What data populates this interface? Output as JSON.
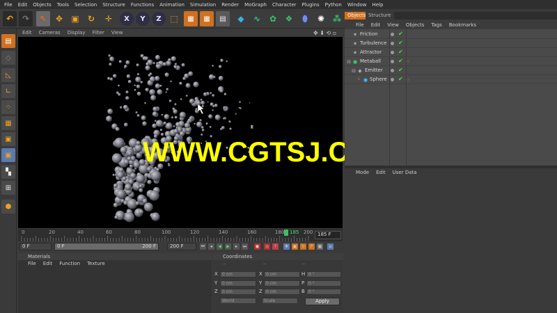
{
  "menubar": [
    "File",
    "Edit",
    "Objects",
    "Tools",
    "Selection",
    "Structure",
    "Functions",
    "Animation",
    "Simulation",
    "Render",
    "MoGraph",
    "Character",
    "Plugins",
    "Python",
    "Window",
    "Help"
  ],
  "toolbar": {
    "axis_x": "X",
    "axis_y": "Y",
    "axis_z": "Z"
  },
  "viewport": {
    "menu": [
      "Edit",
      "Cameras",
      "Display",
      "Filter",
      "View"
    ],
    "nav_icons": "✥ ⬇ ⟲ ▫"
  },
  "watermark": "WWW.CGTSJ.COM",
  "timeline": {
    "ticks": [
      "0",
      "20",
      "40",
      "60",
      "80",
      "100",
      "120",
      "140",
      "160",
      "180",
      "185",
      "200"
    ],
    "current_frame": "185 F"
  },
  "transport": {
    "start": "0 F",
    "range_start": "0 F",
    "range_end": "200 F",
    "end": "200 F"
  },
  "materials": {
    "title": "Materials",
    "menu": [
      "File",
      "Edit",
      "Function",
      "Texture"
    ]
  },
  "coordinates": {
    "title": "Coordinates",
    "headers": [
      "--",
      "--",
      "--"
    ],
    "rows": [
      {
        "axis": "X",
        "pos": "0 cm",
        "axis2": "X",
        "size": "0 cm",
        "axis3": "H",
        "rot": "0 °"
      },
      {
        "axis": "Y",
        "pos": "0 cm",
        "axis2": "Y",
        "size": "0 cm",
        "axis3": "P",
        "rot": "0 °"
      },
      {
        "axis": "Z",
        "pos": "0 cm",
        "axis2": "Z",
        "size": "0 cm",
        "axis3": "B",
        "rot": "0 °"
      }
    ],
    "mode_select": "World",
    "scale_select": "Scale",
    "apply_label": "Apply"
  },
  "objects_panel": {
    "tabs": [
      "Objects",
      "Structure"
    ],
    "menu": [
      "File",
      "Edit",
      "View",
      "Objects",
      "Tags",
      "Bookmarks"
    ],
    "items": [
      {
        "name": "Friction",
        "icon": "✶"
      },
      {
        "name": "Turbulence",
        "icon": "✶"
      },
      {
        "name": "Attractor",
        "icon": "✶"
      },
      {
        "name": "Metaball",
        "icon": "●"
      },
      {
        "name": "Emitter",
        "icon": "◈"
      },
      {
        "name": "Sphere",
        "icon": "●"
      }
    ]
  },
  "attributes_panel": {
    "menu": [
      "Mode",
      "Edit",
      "User Data"
    ]
  }
}
